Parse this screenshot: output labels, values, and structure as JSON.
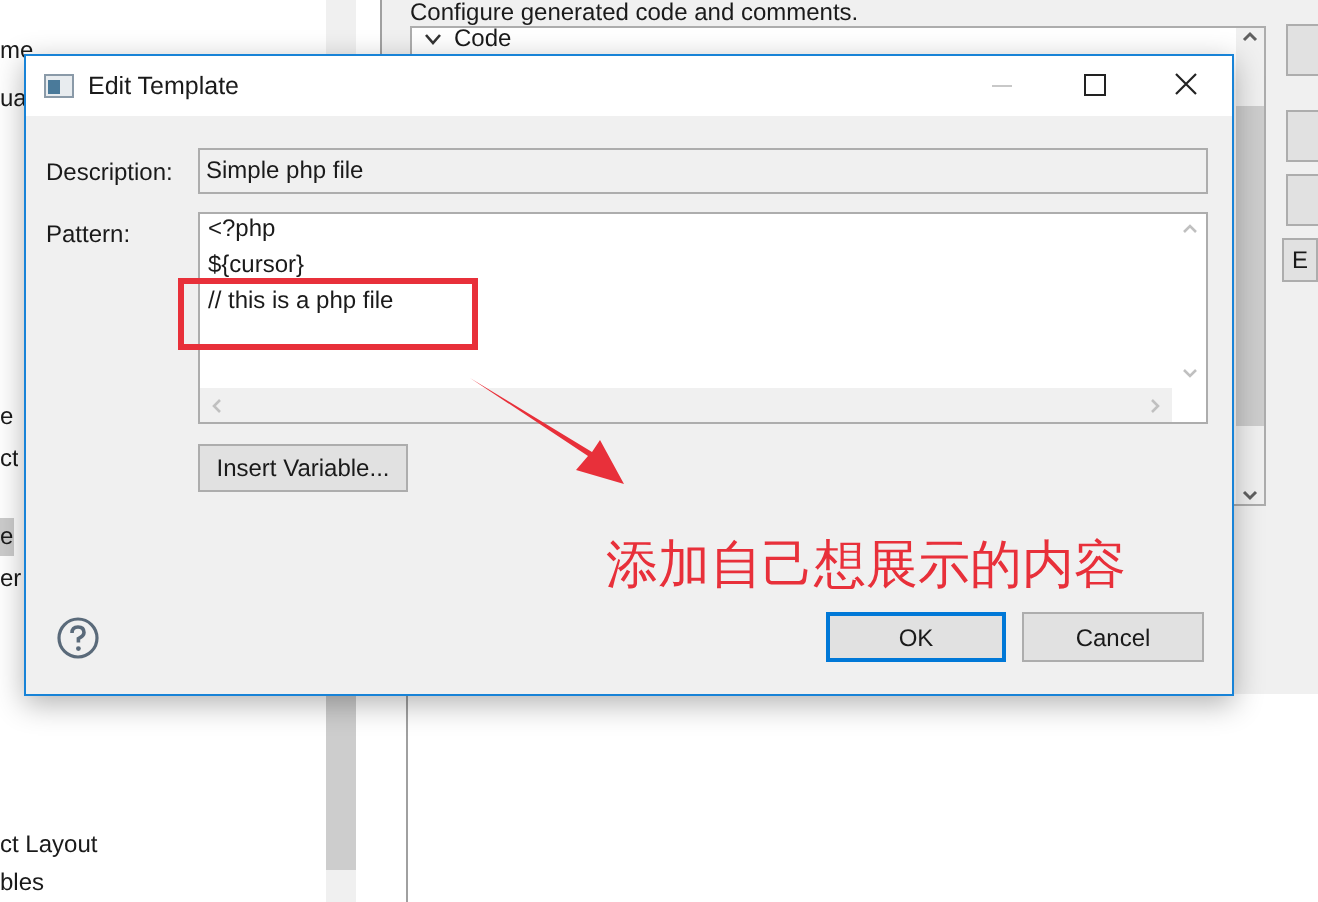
{
  "background_window": {
    "header": "Configure generated code and comments.",
    "tree": [
      {
        "label": "Code",
        "expanded": true
      }
    ],
    "left_items": [
      {
        "label": "me",
        "selected": false
      },
      {
        "label": "ua",
        "selected": false
      },
      {
        "label": "e",
        "selected": false
      },
      {
        "label": "ct",
        "selected": false
      },
      {
        "label": "e",
        "selected": true
      },
      {
        "label": "er",
        "selected": false
      },
      {
        "label": "ct Layout",
        "selected": false
      },
      {
        "label": "bles",
        "selected": false
      }
    ],
    "side_button_label": "E"
  },
  "dialog": {
    "title": "Edit Template",
    "description_label": "Description:",
    "description": "Simple php file",
    "pattern_label": "Pattern:",
    "pattern_lines": [
      "<?php",
      "${cursor}",
      "// this is a php file"
    ],
    "insert_button": "Insert Variable...",
    "ok_button": "OK",
    "cancel_button": "Cancel"
  },
  "annotation": {
    "text": "添加自己想展示的内容"
  }
}
